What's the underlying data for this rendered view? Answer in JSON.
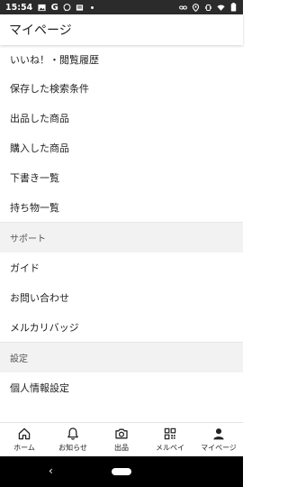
{
  "status": {
    "time": "15:54",
    "left_icons": [
      "image-icon",
      "google-icon",
      "chat-icon",
      "news-icon",
      "dot-icon"
    ],
    "right_icons": [
      "link-icon",
      "location-icon",
      "vibrate-icon",
      "wifi-icon",
      "battery-icon"
    ]
  },
  "header": {
    "title": "マイページ"
  },
  "menu": {
    "group1": [
      "いいね！・閲覧履歴",
      "保存した検索条件",
      "出品した商品",
      "購入した商品",
      "下書き一覧",
      "持ち物一覧"
    ],
    "support_title": "サポート",
    "support": [
      "ガイド",
      "お問い合わせ",
      "メルカリバッジ"
    ],
    "settings_title": "設定",
    "settings": [
      "個人情報設定"
    ]
  },
  "tabs": [
    {
      "label": "ホーム",
      "icon": "home-icon"
    },
    {
      "label": "お知らせ",
      "icon": "bell-icon"
    },
    {
      "label": "出品",
      "icon": "camera-icon"
    },
    {
      "label": "メルペイ",
      "icon": "qr-code-icon"
    },
    {
      "label": "マイページ",
      "icon": "person-icon"
    }
  ],
  "nav": {
    "back_glyph": "‹"
  }
}
